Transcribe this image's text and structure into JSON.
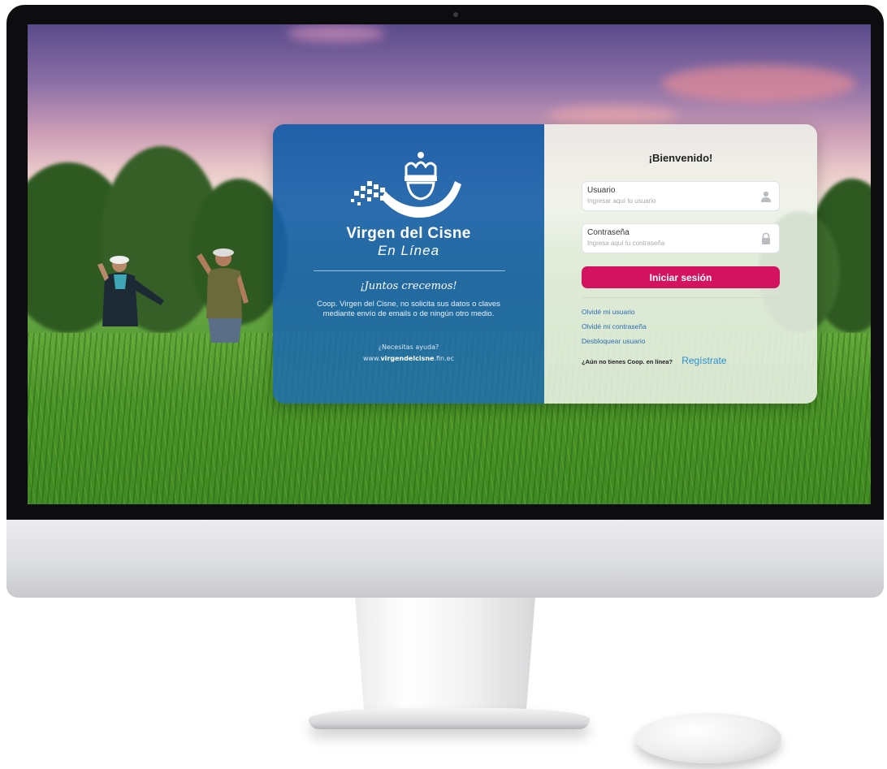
{
  "brand": {
    "name": "Virgen del Cisne",
    "subtitle": "En Línea",
    "slogan": "¡Juntos crecemos!",
    "notice": "Coop. Virgen del Cisne, no solicita sus datos o claves mediante envío de emails o de ningún otro medio.",
    "help": "¿Necesitas ayuda?",
    "site_prefix": "www.",
    "site_bold": "virgendelcisne",
    "site_suffix": ".fin.ec",
    "color": "#1a5fa8"
  },
  "login": {
    "welcome": "¡Bienvenido!",
    "user_label": "Usuario",
    "user_placeholder": "Ingresar aquí tu usuario",
    "password_label": "Contraseña",
    "password_placeholder": "Ingresa aquí tu contraseña",
    "submit_label": "Iniciar sesión",
    "accent": "#d3135f",
    "links": {
      "forgot_user": "Olvidé mi usuario",
      "forgot_password": "Olvidé mi contraseña",
      "unlock_user": "Desbloquear usuario"
    },
    "register_question": "¿Aún no tienes Coop. en línea?",
    "register_link": "Regístrate"
  },
  "icons": {
    "user_field": "user-icon",
    "password_field": "lock-icon",
    "logo": "crown-swan-logo"
  }
}
